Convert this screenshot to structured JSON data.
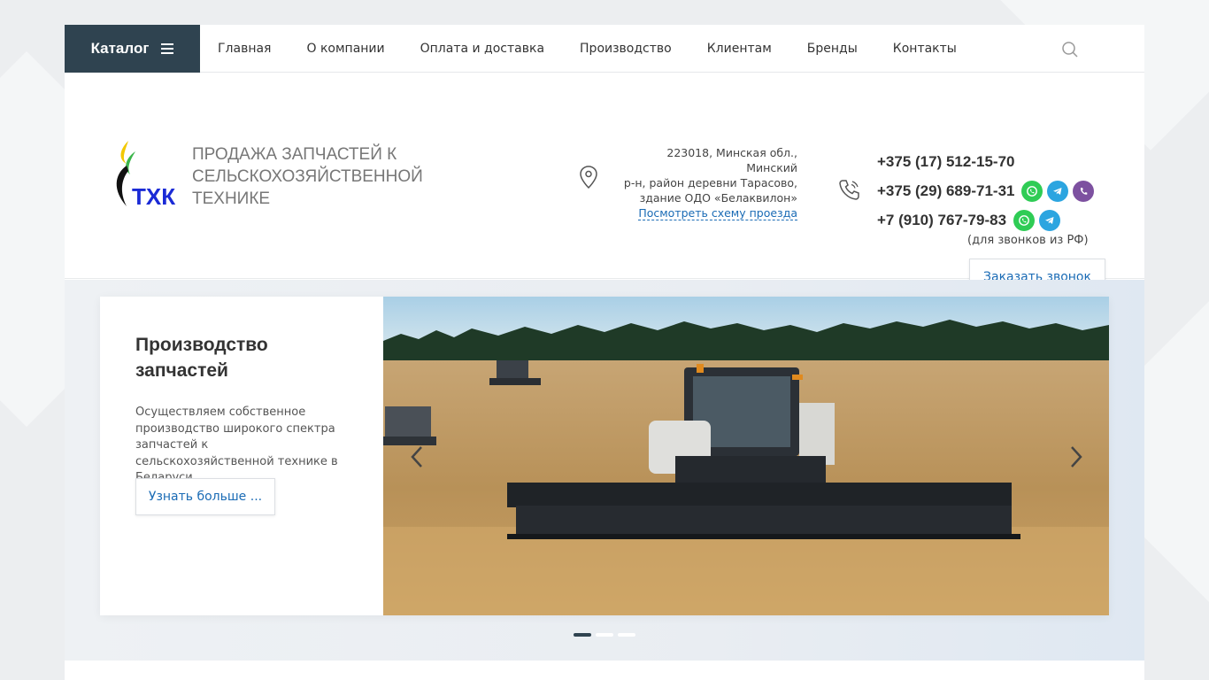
{
  "nav": {
    "catalog_label": "Каталог",
    "items": [
      "Главная",
      "О компании",
      "Оплата и доставка",
      "Производство",
      "Клиентам",
      "Бренды",
      "Контакты"
    ],
    "search_icon": "search-icon"
  },
  "header": {
    "logo_text": "ТХК",
    "tagline": "ПРОДАЖА ЗАПЧАСТЕЙ К СЕЛЬСКОХОЗЯЙСТВЕННОЙ ТЕХНИКЕ",
    "address_lines": [
      "223018, Минская обл., Минский",
      "р-н, район деревни Тарасово,",
      "здание ОДО «Белаквилон»"
    ],
    "route_link": "Посмотреть схему проезда",
    "phones": [
      "+375 (17) 512-15-70",
      "+375 (29) 689-71-31",
      "+7 (910) 767-79-83"
    ],
    "call_note": "(для звонков из РФ)",
    "callback_label": "Заказать звонок"
  },
  "slider": {
    "title": "Производство запчастей",
    "text": "Осуществляем собственное производство широкого спектра запчастей к сельскохозяйственной технике в Беларуси.",
    "button_label": "Узнать больше ...",
    "active_slide": 1,
    "slide_count": 3
  },
  "colors": {
    "dark_nav": "#2f4350",
    "link_blue": "#1a6bb5",
    "whatsapp": "#2fcc55",
    "telegram": "#2ca5e0",
    "viber": "#7d51a0"
  }
}
